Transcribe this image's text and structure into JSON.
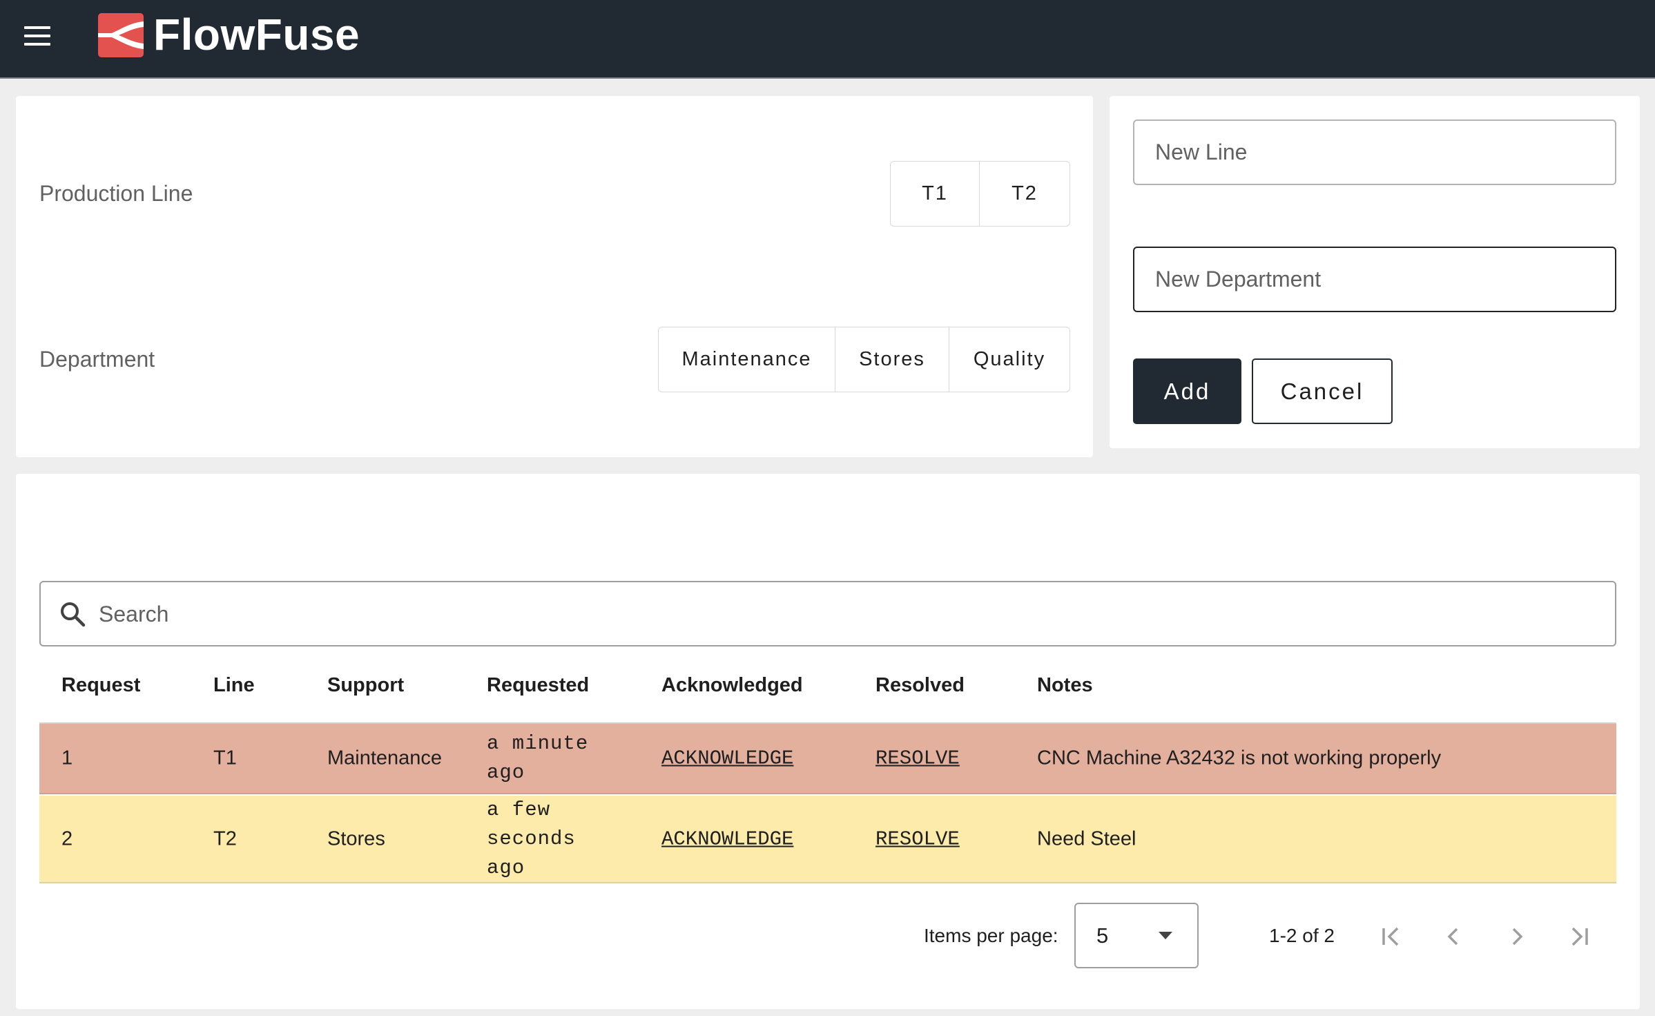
{
  "header": {
    "brand": "FlowFuse",
    "menu_icon": "hamburger-menu-icon",
    "logo_icon": "flowfuse-logo-icon",
    "bg_color": "#212a33",
    "logo_color": "#e3524e"
  },
  "selectors": {
    "production_line": {
      "label": "Production Line",
      "options": [
        "T1",
        "T2"
      ]
    },
    "department": {
      "label": "Department",
      "options": [
        "Maintenance",
        "Stores",
        "Quality"
      ]
    }
  },
  "add_form": {
    "new_line_placeholder": "New Line",
    "new_department_placeholder": "New Department",
    "add_label": "Add",
    "cancel_label": "Cancel"
  },
  "table": {
    "search_placeholder": "Search",
    "search_icon": "search-icon",
    "columns": [
      "Request",
      "Line",
      "Support",
      "Requested",
      "Acknowledged",
      "Resolved",
      "Notes"
    ],
    "rows": [
      {
        "request": "1",
        "line": "T1",
        "support": "Maintenance",
        "requested": "a minute ago",
        "acknowledged": "ACKNOWLEDGE",
        "resolved": "RESOLVE",
        "notes": "CNC Machine A32432 is not working properly",
        "row_color": "#e4b09e"
      },
      {
        "request": "2",
        "line": "T2",
        "support": "Stores",
        "requested": "a few seconds ago",
        "acknowledged": "ACKNOWLEDGE",
        "resolved": "RESOLVE",
        "notes": "Need Steel",
        "row_color": "#fcebab"
      }
    ]
  },
  "pagination": {
    "items_per_page_label": "Items per page:",
    "items_per_page_value": "5",
    "range_text": "1-2 of 2"
  }
}
